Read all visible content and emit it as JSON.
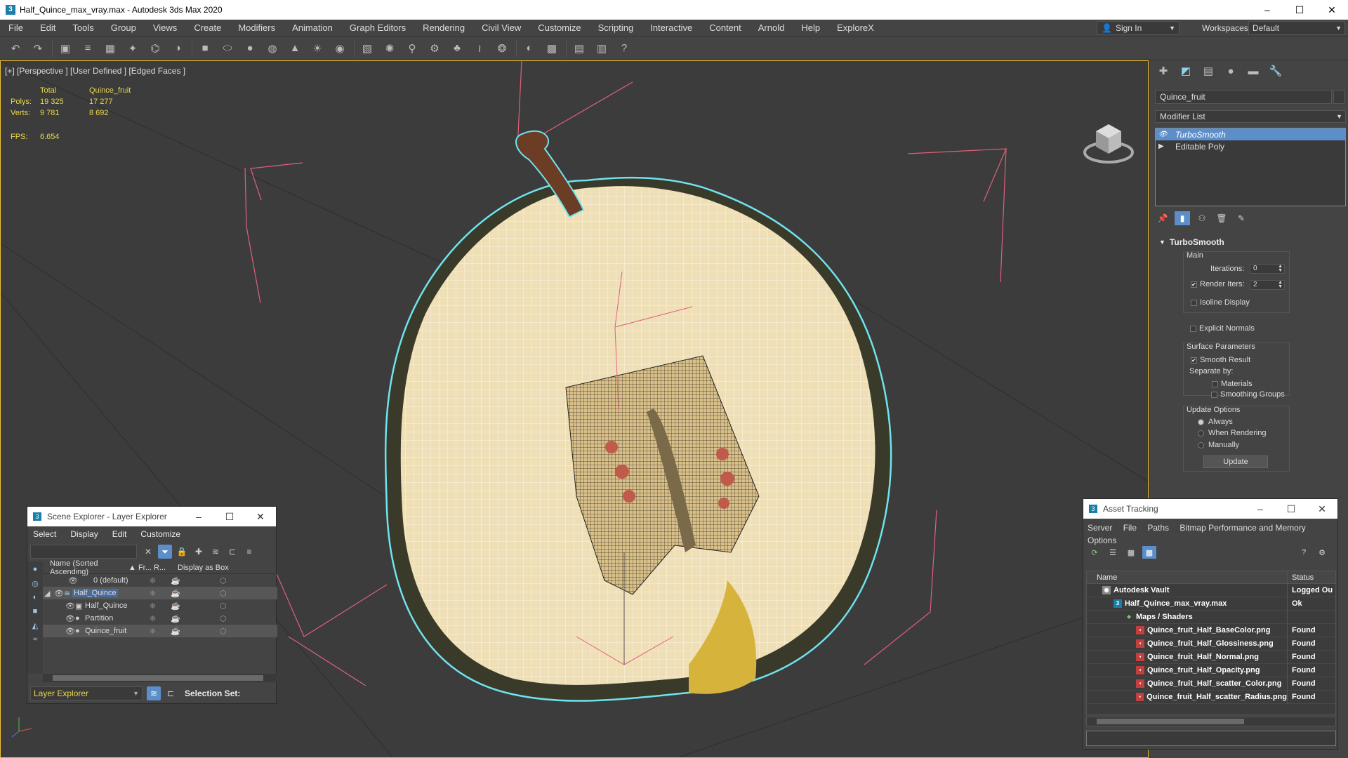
{
  "window": {
    "title": "Half_Quince_max_vray.max - Autodesk 3ds Max 2020",
    "app_icon_letter": "3",
    "buttons": [
      "–",
      "☐",
      "✕"
    ]
  },
  "menubar": {
    "items": [
      "File",
      "Edit",
      "Tools",
      "Group",
      "Views",
      "Create",
      "Modifiers",
      "Animation",
      "Graph Editors",
      "Rendering",
      "Civil View",
      "Customize",
      "Scripting",
      "Interactive",
      "Content",
      "Arnold",
      "Help",
      "ExploreX"
    ],
    "sign_in": "Sign In",
    "workspaces_label": "Workspaces:",
    "workspace_value": "Default"
  },
  "toolbar": {
    "icons": [
      "undo-icon",
      "redo-icon",
      "render-setup-icon",
      "layers-icon",
      "toolbox-icon",
      "light-icon",
      "snap-icon",
      "mirror-icon",
      "box-icon",
      "cylinder-icon",
      "sphere-icon",
      "torus-icon",
      "cone-icon",
      "sun-icon",
      "bulb-icon",
      "grid-icon",
      "particle-icon",
      "bone-icon",
      "gear-icon",
      "plant-icon",
      "hair-icon",
      "scatter-icon",
      "material-icon",
      "render-icon",
      "render-frame-icon",
      "asset-icon",
      "help-icon"
    ]
  },
  "viewport": {
    "label": "[+] [Perspective ] [User Defined ] [Edged Faces ]",
    "stats": {
      "header_total": "Total",
      "header_object": "Quince_fruit",
      "rows": [
        {
          "label": "Polys:",
          "total": "19 325",
          "object": "17 277"
        },
        {
          "label": "Verts:",
          "total": "9 781",
          "object": "8 692"
        }
      ],
      "fps_label": "FPS:",
      "fps_value": "6.654"
    }
  },
  "scene_explorer": {
    "title": "Scene Explorer - Layer Explorer",
    "menu": [
      "Select",
      "Display",
      "Edit",
      "Customize"
    ],
    "columns": [
      "Name (Sorted Ascending)",
      "▲ Fr...",
      "R...",
      "Display as Box"
    ],
    "rows": [
      {
        "name": "0 (default)",
        "indent": 0
      },
      {
        "name": "Half_Quince",
        "indent": 0,
        "expanded": true,
        "highlight": true
      },
      {
        "name": "Half_Quince",
        "indent": 1
      },
      {
        "name": "Partition",
        "indent": 1
      },
      {
        "name": "Quince_fruit",
        "indent": 1,
        "selected": true
      }
    ],
    "footer_layer": "Layer Explorer",
    "footer_selection": "Selection Set:"
  },
  "command_panel": {
    "object_name": "Quince_fruit",
    "modifier_list": "Modifier List",
    "stack": [
      {
        "label": "TurboSmooth",
        "selected": true
      },
      {
        "label": "Editable Poly",
        "selected": false
      }
    ],
    "rollout_title": "TurboSmooth",
    "main_label": "Main",
    "iterations_label": "Iterations:",
    "iterations_value": "0",
    "render_iters_label": "Render Iters:",
    "render_iters_value": "2",
    "isoline_label": "Isoline Display",
    "explicit_normals_label": "Explicit Normals",
    "surface_params_label": "Surface Parameters",
    "smooth_result_label": "Smooth Result",
    "separate_by_label": "Separate by:",
    "materials_label": "Materials",
    "smoothing_groups_label": "Smoothing Groups",
    "update_options_label": "Update Options",
    "always_label": "Always",
    "when_rendering_label": "When Rendering",
    "manually_label": "Manually",
    "update_button": "Update"
  },
  "asset_tracking": {
    "title": "Asset Tracking",
    "menu_line1": [
      "Server",
      "File",
      "Paths",
      "Bitmap Performance and Memory"
    ],
    "menu_line2": [
      "Options"
    ],
    "col_name": "Name",
    "col_status": "Status",
    "rows": [
      {
        "name": "Autodesk Vault",
        "status": "Logged Ou",
        "indent": 0,
        "icon": "vault"
      },
      {
        "name": "Half_Quince_max_vray.max",
        "status": "Ok",
        "indent": 1,
        "icon": "max"
      },
      {
        "name": "Maps / Shaders",
        "status": "",
        "indent": 2,
        "icon": "maps"
      },
      {
        "name": "Quince_fruit_Half_BaseColor.png",
        "status": "Found",
        "indent": 3,
        "icon": "png"
      },
      {
        "name": "Quince_fruit_Half_Glossiness.png",
        "status": "Found",
        "indent": 3,
        "icon": "png"
      },
      {
        "name": "Quince_fruit_Half_Normal.png",
        "status": "Found",
        "indent": 3,
        "icon": "png"
      },
      {
        "name": "Quince_fruit_Half_Opacity.png",
        "status": "Found",
        "indent": 3,
        "icon": "png"
      },
      {
        "name": "Quince_fruit_Half_scatter_Color.png",
        "status": "Found",
        "indent": 3,
        "icon": "png"
      },
      {
        "name": "Quince_fruit_Half_scatter_Radius.png",
        "status": "Found",
        "indent": 3,
        "icon": "png"
      }
    ]
  },
  "colors": {
    "selection_blue": "#5c8ec9",
    "stats_yellow": "#e9d84d",
    "wire_cyan": "#6fe3ef",
    "bbox_pink": "#e0607c"
  }
}
